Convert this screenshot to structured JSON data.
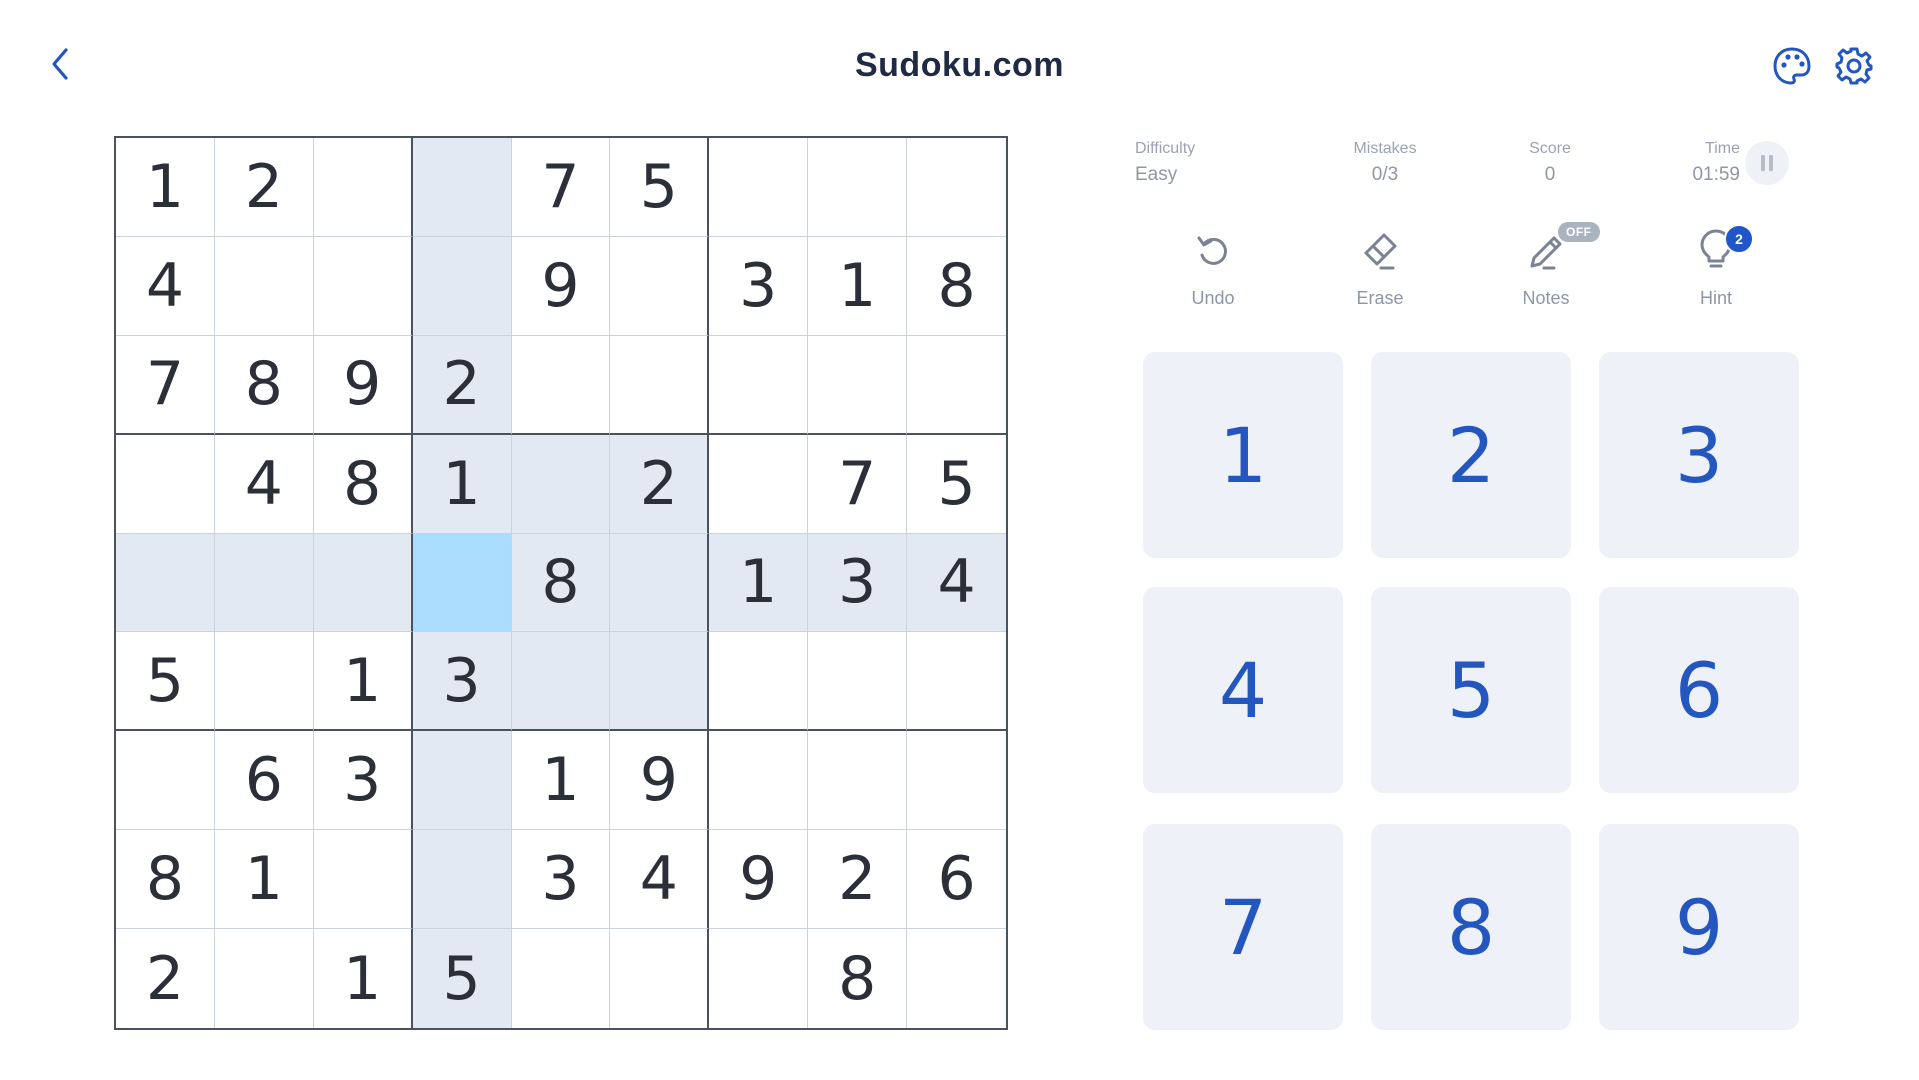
{
  "header": {
    "title": "Sudoku.com",
    "back_icon": "chevron-left-icon",
    "theme_icon": "palette-icon",
    "settings_icon": "gear-icon"
  },
  "colors": {
    "accent": "#2456c0",
    "highlight": "#e2e9f3",
    "selected": "#abdefe",
    "digit": "#2b2f38"
  },
  "board": {
    "rows": [
      [
        "1",
        "2",
        "",
        "",
        "7",
        "5",
        "",
        "",
        ""
      ],
      [
        "4",
        "",
        "",
        "",
        "9",
        "",
        "3",
        "1",
        "8"
      ],
      [
        "7",
        "8",
        "9",
        "2",
        "",
        "",
        "",
        "",
        ""
      ],
      [
        "",
        "4",
        "8",
        "1",
        "",
        "2",
        "",
        "7",
        "5"
      ],
      [
        "",
        "",
        "",
        "",
        "8",
        "",
        "1",
        "3",
        "4"
      ],
      [
        "5",
        "",
        "1",
        "3",
        "",
        "",
        "",
        "",
        ""
      ],
      [
        "",
        "6",
        "3",
        "",
        "1",
        "9",
        "",
        "",
        ""
      ],
      [
        "8",
        "1",
        "",
        "",
        "3",
        "4",
        "9",
        "2",
        "6"
      ],
      [
        "2",
        "",
        "1",
        "5",
        "",
        "",
        "",
        "8",
        ""
      ]
    ],
    "selected_row": 5,
    "selected_col": 4
  },
  "stats": {
    "difficulty_label": "Difficulty",
    "difficulty_value": "Easy",
    "mistakes_label": "Mistakes",
    "mistakes_value": "0/3",
    "score_label": "Score",
    "score_value": "0",
    "time_label": "Time",
    "time_value": "01:59",
    "pause_icon": "pause-icon"
  },
  "tools": {
    "undo_label": "Undo",
    "erase_label": "Erase",
    "notes_label": "Notes",
    "notes_state": "OFF",
    "hint_label": "Hint",
    "hint_count": "2"
  },
  "numpad": [
    "1",
    "2",
    "3",
    "4",
    "5",
    "6",
    "7",
    "8",
    "9"
  ]
}
